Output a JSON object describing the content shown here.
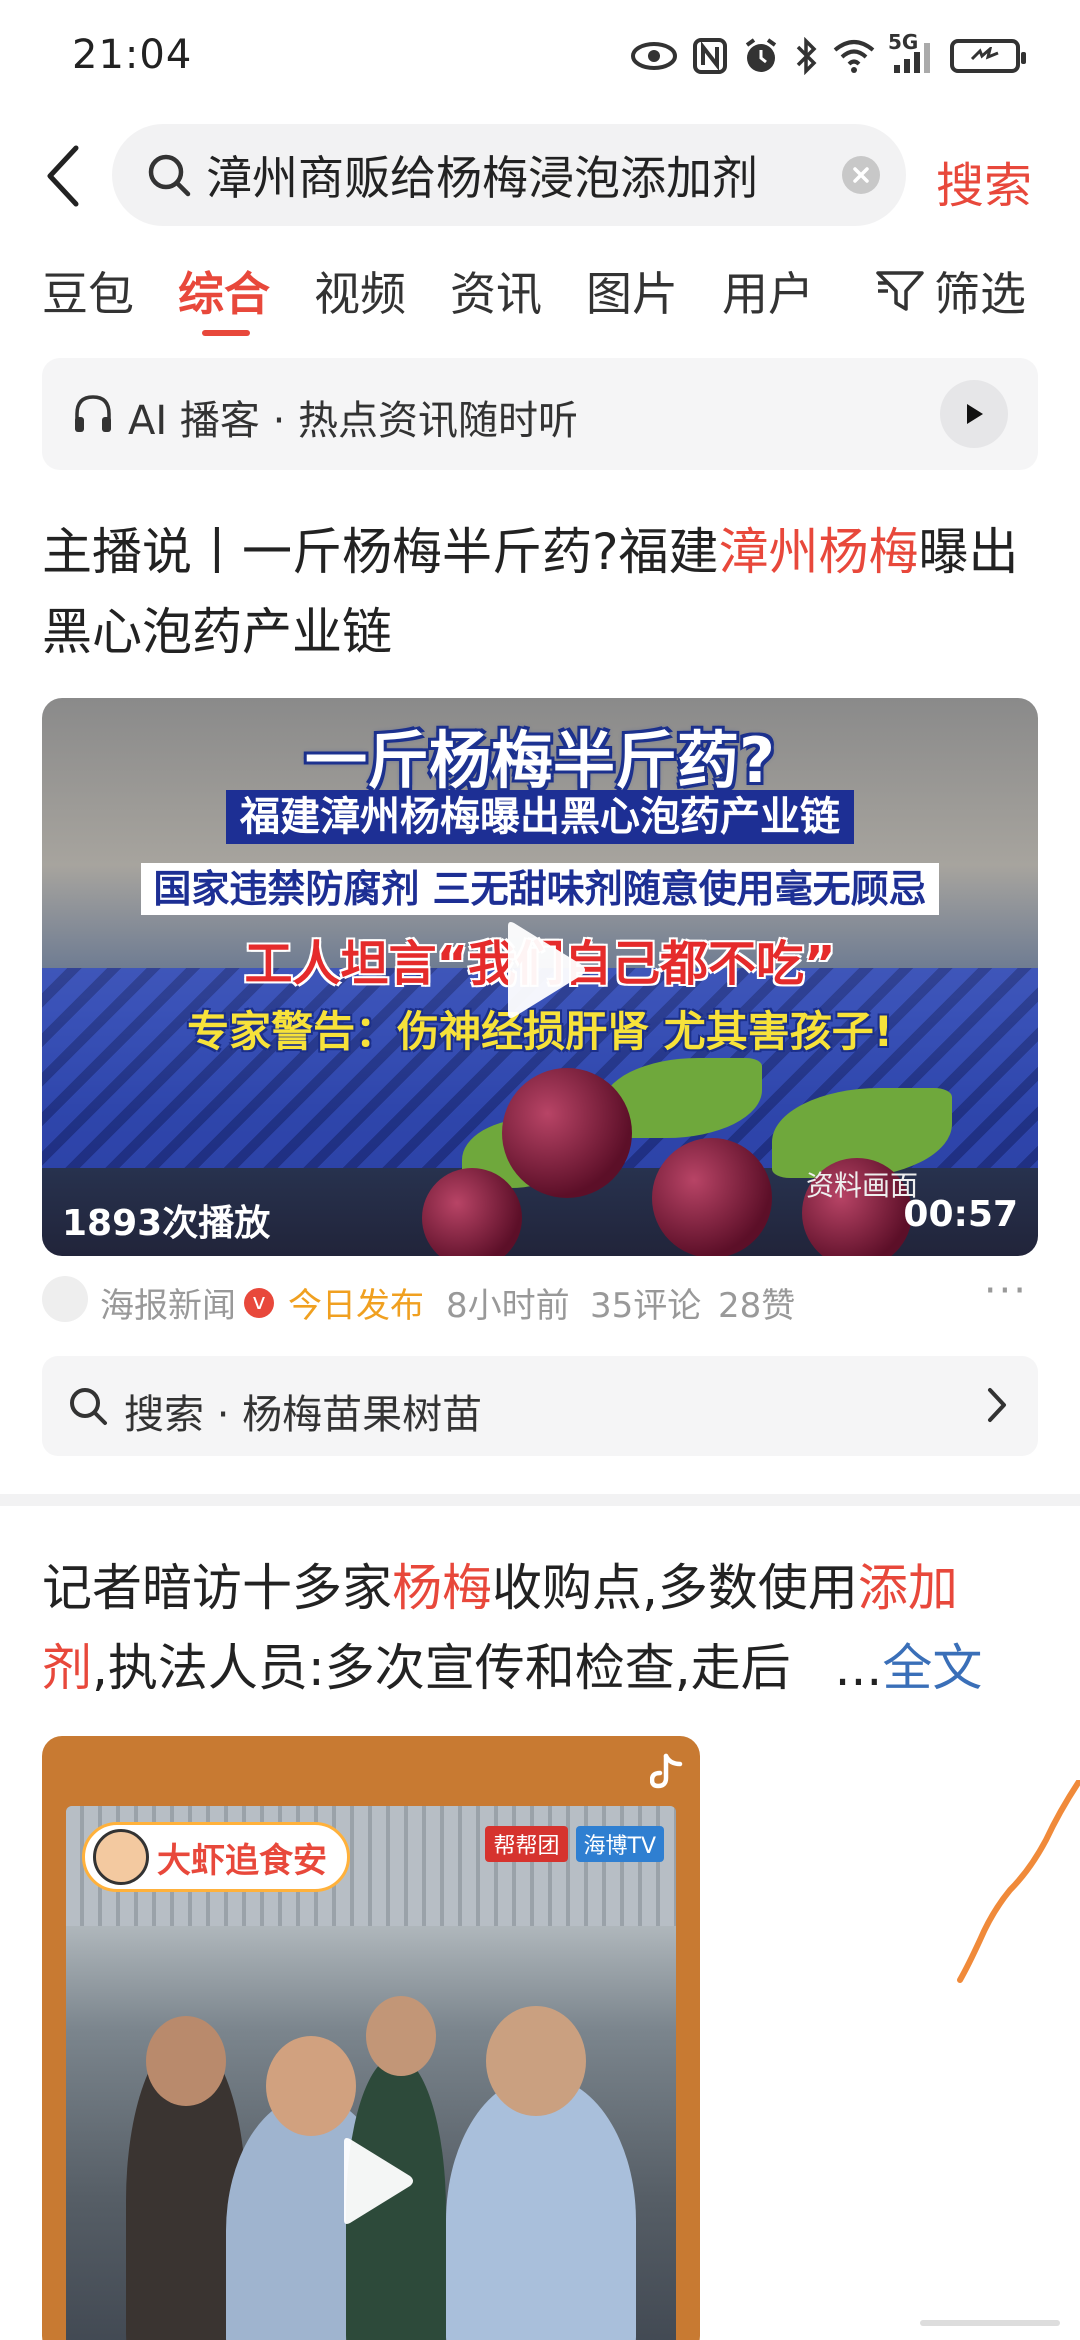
{
  "status_bar": {
    "time": "21:04",
    "network": "5G",
    "icons": [
      "eye-icon",
      "nfc-icon",
      "alarm-icon",
      "bluetooth-icon",
      "wifi-icon",
      "signal-icon",
      "battery-icon"
    ]
  },
  "header": {
    "search_query": "漳州商贩给杨梅浸泡添加剂",
    "search_button": "搜索"
  },
  "tabs": {
    "items": [
      "豆包",
      "综合",
      "视频",
      "资讯",
      "图片",
      "用户"
    ],
    "active": "综合",
    "filter_label": "筛选"
  },
  "ai_bar": {
    "text": "AI 播客 · 热点资讯随时听"
  },
  "article1": {
    "title_parts": [
      "主播说丨一斤杨梅半斤药?福建",
      "漳州杨梅",
      "曝出黑心泡药产业链"
    ],
    "video": {
      "caption_1": "一斤杨梅半斤药?",
      "caption_2": "福建漳州杨梅曝出黑心泡药产业链",
      "caption_3": "国家违禁防腐剂 三无甜味剂随意使用毫无顾忌",
      "caption_4": "工人坦言“我们自己都不吃”",
      "caption_5": "专家警告：伤神经损肝肾 尤其害孩子!",
      "source_note": "资料画面",
      "play_count": "1893次播放",
      "duration": "00:57"
    },
    "meta": {
      "source": "海报新闻",
      "badge": "v",
      "published": "今日发布",
      "time_ago": "8小时前",
      "comments": "35评论",
      "likes": "28赞",
      "more": "···"
    },
    "related_search": "搜索 · 杨梅苗果树苗"
  },
  "article2": {
    "title_parts": [
      "记者暗访十多家",
      "杨梅",
      "收购点,多数使用",
      "添加",
      "剂",
      ",执法人员:多次宣传和检查,走后"
    ],
    "ellipsis": "...",
    "more_link": "全文",
    "video": {
      "brand_name": "大虾追食安",
      "tag_1": "帮帮团",
      "tag_2": "海博TV"
    }
  },
  "colors": {
    "accent": "#e8483b",
    "link": "#3a6fb8",
    "published": "#f0a020",
    "card_bg": "#f5f5f6"
  }
}
